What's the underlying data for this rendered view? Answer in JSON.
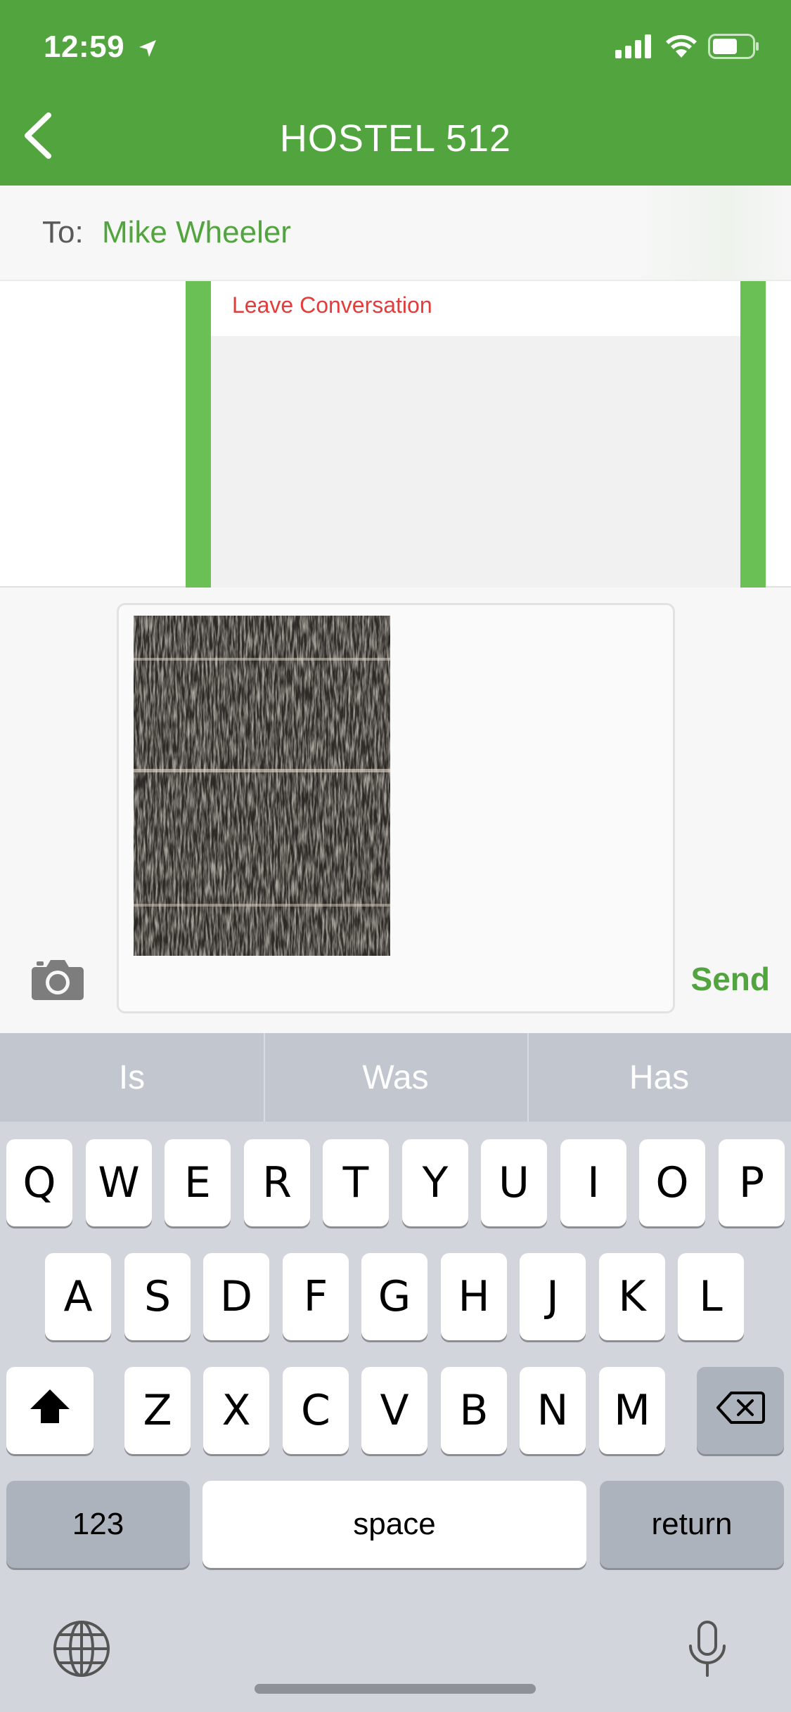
{
  "status_bar": {
    "time": "12:59"
  },
  "header": {
    "title": "HOSTEL 512"
  },
  "recipient": {
    "label": "To:",
    "name": "Mike Wheeler"
  },
  "menu": {
    "leave_label": "Leave Conversation"
  },
  "composer": {
    "send_label": "Send"
  },
  "keyboard": {
    "suggestions": [
      "Is",
      "Was",
      "Has"
    ],
    "row1": [
      "Q",
      "W",
      "E",
      "R",
      "T",
      "Y",
      "U",
      "I",
      "O",
      "P"
    ],
    "row2": [
      "A",
      "S",
      "D",
      "F",
      "G",
      "H",
      "J",
      "K",
      "L"
    ],
    "row3": [
      "Z",
      "X",
      "C",
      "V",
      "B",
      "N",
      "M"
    ],
    "numbers_label": "123",
    "space_label": "space",
    "return_label": "return"
  },
  "colors": {
    "brand_green": "#52a43e",
    "accent_green": "#6abf55",
    "danger_red": "#e43b3b"
  },
  "icons": [
    "location-arrow-icon",
    "signal-icon",
    "wifi-icon",
    "battery-icon",
    "back-chevron-icon",
    "camera-icon",
    "shift-icon",
    "backspace-icon",
    "globe-icon",
    "microphone-icon"
  ]
}
